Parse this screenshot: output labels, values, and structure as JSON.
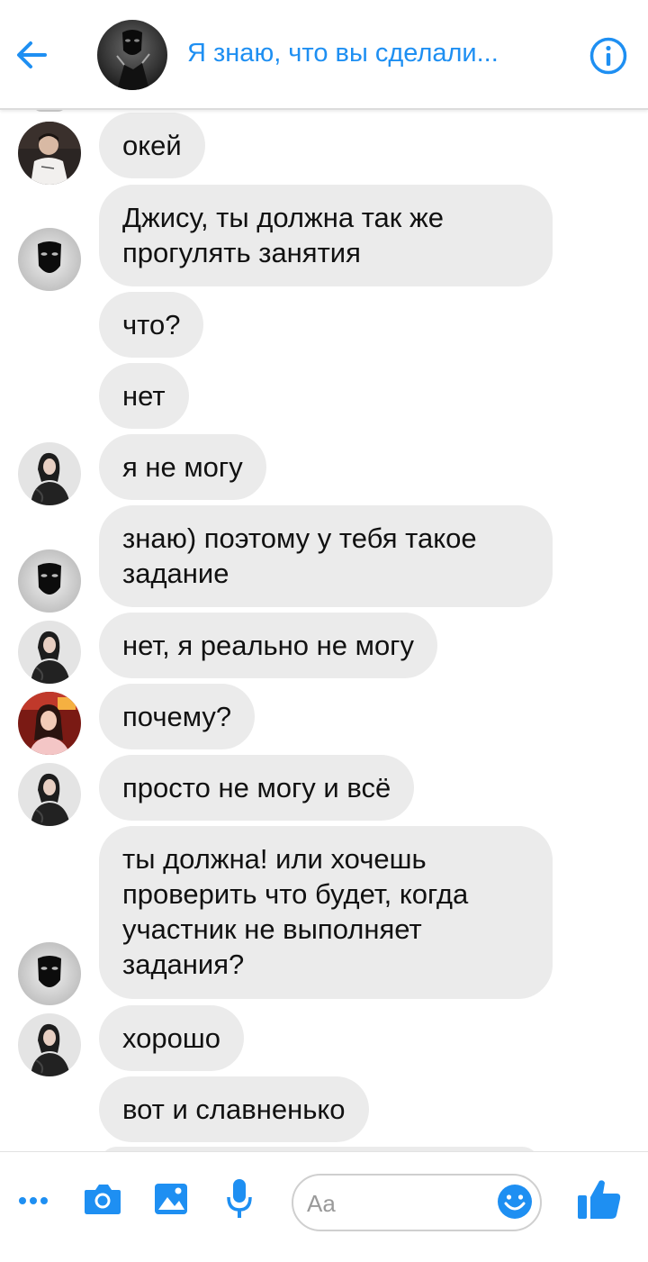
{
  "header": {
    "title": "Я знаю, что вы сделали..."
  },
  "messages": [
    {
      "text": "окей"
    },
    {
      "text": "Джису, ты должна так же\nпрогулять занятия"
    },
    {
      "text": "что?"
    },
    {
      "text": "нет"
    },
    {
      "text": "я не могу"
    },
    {
      "text": "знаю) поэтому у тебя такое\nзадание"
    },
    {
      "text": "нет, я реально не могу"
    },
    {
      "text": "почему?"
    },
    {
      "text": "просто не могу и всё"
    },
    {
      "text": "ты должна! или хочешь\nпроверить что будет, когда\nучастник не выполняет\nзадания?"
    },
    {
      "text": "хорошо"
    },
    {
      "text": "вот и славненько"
    }
  ],
  "composer": {
    "placeholder": "Aa"
  },
  "colors": {
    "accent": "#1e8ff2",
    "bubble": "#ebebeb"
  }
}
